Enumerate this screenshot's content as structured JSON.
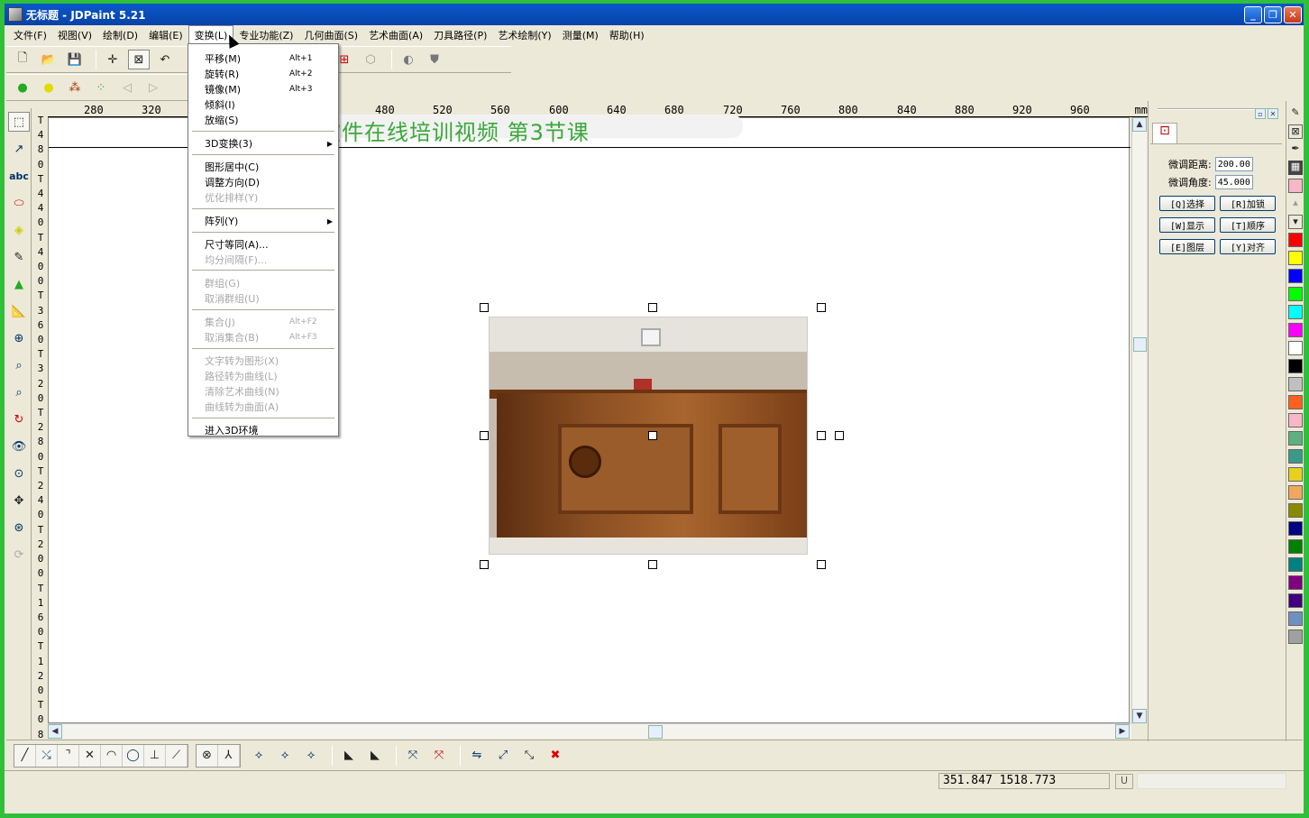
{
  "window": {
    "title": "无标题 - JDPaint 5.21",
    "buttons": [
      "_",
      "❐",
      "✕"
    ]
  },
  "menubar": [
    "文件(F)",
    "视图(V)",
    "绘制(D)",
    "编辑(E)",
    "变换(L)",
    "专业功能(Z)",
    "几何曲面(S)",
    "艺术曲面(A)",
    "刀具路径(P)",
    "艺术绘制(Y)",
    "测量(M)",
    "帮助(H)"
  ],
  "active_menu": "变换(L)",
  "dropdown": {
    "items": [
      {
        "label": "平移(M)",
        "shortcut": "Alt+1",
        "disabled": false
      },
      {
        "label": "旋转(R)",
        "shortcut": "Alt+2",
        "disabled": false
      },
      {
        "label": "镜像(M)",
        "shortcut": "Alt+3",
        "disabled": false
      },
      {
        "label": "倾斜(I)",
        "shortcut": "",
        "disabled": false
      },
      {
        "label": "放缩(S)",
        "shortcut": "",
        "disabled": false
      },
      {
        "label": "3D变换(3)",
        "shortcut": "",
        "disabled": false,
        "submenu": true
      },
      {
        "label": "图形居中(C)",
        "shortcut": "",
        "disabled": false
      },
      {
        "label": "调整方向(D)",
        "shortcut": "",
        "disabled": false
      },
      {
        "label": "优化排样(Y)",
        "shortcut": "",
        "disabled": true
      },
      {
        "label": "阵列(Y)",
        "shortcut": "",
        "disabled": false,
        "submenu": true
      },
      {
        "label": "尺寸等同(A)...",
        "shortcut": "",
        "disabled": false
      },
      {
        "label": "均分间隔(F)...",
        "shortcut": "",
        "disabled": true
      },
      {
        "label": "群组(G)",
        "shortcut": "",
        "disabled": true
      },
      {
        "label": "取消群组(U)",
        "shortcut": "",
        "disabled": true
      },
      {
        "label": "集合(J)",
        "shortcut": "Alt+F2",
        "disabled": true
      },
      {
        "label": "取消集合(B)",
        "shortcut": "Alt+F3",
        "disabled": true
      },
      {
        "label": "文字转为图形(X)",
        "shortcut": "",
        "disabled": true
      },
      {
        "label": "路径转为曲线(L)",
        "shortcut": "",
        "disabled": true
      },
      {
        "label": "清除艺术曲线(N)",
        "shortcut": "",
        "disabled": true
      },
      {
        "label": "曲线转为曲面(A)",
        "shortcut": "",
        "disabled": true
      },
      {
        "label": "进入3D环境",
        "shortcut": "",
        "disabled": false
      }
    ]
  },
  "banner": "精雕软件在线培训视频 第3节课",
  "ruler": {
    "h_ticks": [
      "280",
      "320",
      "480",
      "520",
      "560",
      "600",
      "640",
      "680",
      "720",
      "760",
      "800",
      "840",
      "880",
      "920",
      "960"
    ],
    "unit": "mm",
    "v_chars": [
      "T",
      "4",
      "8",
      "0",
      "T",
      "4",
      "4",
      "0",
      "T",
      "4",
      "0",
      "0",
      "T",
      "3",
      "6",
      "0",
      "T",
      "3",
      "2",
      "0",
      "T",
      "2",
      "8",
      "0",
      "T",
      "2",
      "4",
      "0",
      "T",
      "2",
      "0",
      "0",
      "T",
      "1",
      "6",
      "0",
      "T",
      "1",
      "2",
      "0",
      "T",
      "0",
      "8"
    ]
  },
  "right_panel": {
    "tab_icon": "select-tab-icon",
    "fine_distance_label": "微调距离:",
    "fine_distance_value": "200.00",
    "fine_angle_label": "微调角度:",
    "fine_angle_value": "45.000",
    "buttons": [
      "[Q]选择",
      "[R]加锁",
      "[W]显示",
      "[T]顺序",
      "[E]图层",
      "[Y]对齐"
    ]
  },
  "palette": {
    "colors": [
      "#ff0000",
      "#ffff00",
      "#0000ff",
      "#00ff00",
      "#00ffff",
      "#ff00ff",
      "#ffffff",
      "#000000",
      "#c0c0c0",
      "#ff6020",
      "#f7b7c7",
      "#5db080",
      "#3a9a8a",
      "#e8d020",
      "#f0a860",
      "#8a8a00",
      "#000080",
      "#008000",
      "#008080",
      "#800080",
      "#400080",
      "#7090c0",
      "#a0a0a0"
    ]
  },
  "status": {
    "coords": "351.847 1518.773",
    "indicator": "U"
  },
  "icons": {
    "toolbar_top": [
      "new-file-icon",
      "open-file-icon",
      "save-icon",
      "crosshair-icon",
      "box-select-icon",
      "undo-icon"
    ],
    "toolbar_second": [
      "green-pin-icon",
      "yellow-pin-icon",
      "multi-pin-icon",
      "cluster-icon",
      "back-arrow-icon",
      "forward-arrow-icon"
    ],
    "left_tools": [
      "select-rect-icon",
      "node-edit-icon",
      "text-abc-icon",
      "shape-icon",
      "eraser-icon",
      "pen-icon",
      "paint-bucket-icon",
      "measure-icon",
      "zoom-window-icon",
      "zoom-in-icon",
      "zoom-out-icon",
      "redraw-icon",
      "view-eye-icon",
      "zoom-all-icon",
      "pan-icon",
      "zoom-real-icon",
      "rotate-view-icon"
    ],
    "bottom_tools": [
      "line-icon",
      "extend-icon",
      "corner-icon",
      "trim-icon",
      "arc-icon",
      "circle-icon",
      "perpendicular-icon",
      "break-icon",
      "close-icon",
      "join-icon",
      "node1-icon",
      "node2-icon",
      "node3-icon",
      "sweep1-icon",
      "sweep2-icon",
      "delete-node1-icon",
      "delete-node2-icon",
      "align-icon",
      "link-icon",
      "explode-icon",
      "delete-icon"
    ]
  }
}
